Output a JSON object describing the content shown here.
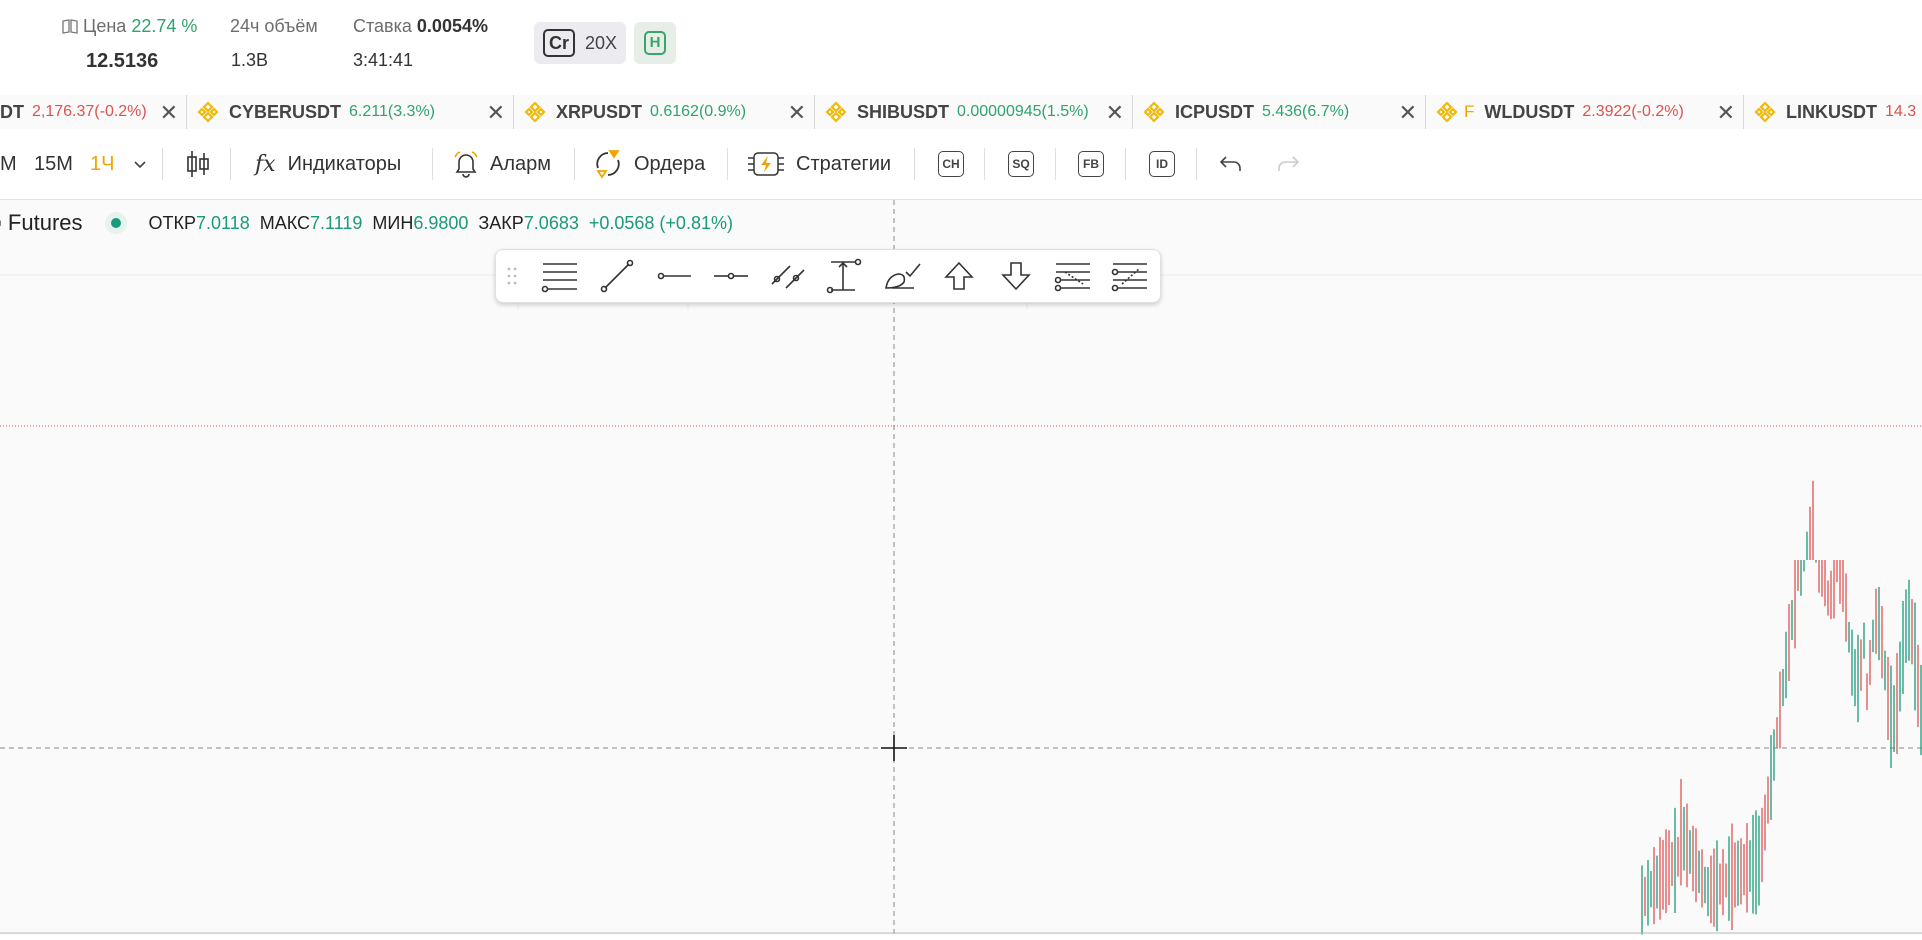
{
  "stats": {
    "price": {
      "label": "Цена",
      "pct": "22.74 %",
      "value": "12.5136"
    },
    "volume": {
      "label": "24ч объём",
      "value": "1.3B"
    },
    "rate": {
      "label": "Ставка",
      "pct": "0.0054%",
      "value": "3:41:41"
    },
    "cr_label": "Cr",
    "leverage": "20X",
    "h_label": "H"
  },
  "tabs": [
    {
      "symbol": "DT",
      "change": "2,176.37(-0.2%)",
      "direction": "down",
      "prefix": "",
      "close": "✕"
    },
    {
      "symbol": "CYBERUSDT",
      "change": "6.211(3.3%)",
      "direction": "up",
      "prefix": "",
      "close": "✕"
    },
    {
      "symbol": "XRPUSDT",
      "change": "0.6162(0.9%)",
      "direction": "up",
      "prefix": "",
      "close": "✕"
    },
    {
      "symbol": "SHIBUSDT",
      "change": "0.00000945(1.5%)",
      "direction": "up",
      "prefix": "",
      "close": "✕"
    },
    {
      "symbol": "ICPUSDT",
      "change": "5.436(6.7%)",
      "direction": "up",
      "prefix": "",
      "close": "✕"
    },
    {
      "symbol": "WLDUSDT",
      "change": "2.3922(-0.2%)",
      "direction": "down",
      "prefix": "F",
      "close": "✕"
    },
    {
      "symbol": "LINKUSDT",
      "change": "14.3",
      "direction": "down",
      "prefix": "",
      "close": ""
    }
  ],
  "toolbar": {
    "tf_m": "M",
    "tf_15m": "15M",
    "tf_1h": "1Ч",
    "indicators": "Индикаторы",
    "alarm": "Аларм",
    "orders": "Ордера",
    "strategies": "Стратегии",
    "ch": "CH",
    "sq": "SQ",
    "fb": "FB",
    "id": "ID"
  },
  "legend": {
    "title": "Futures",
    "open_label": "ОТКР",
    "open": "7.0118",
    "high_label": "МАКС",
    "high": "7.1119",
    "low_label": "МИН",
    "low": "6.9800",
    "close_label": "ЗАКР",
    "close": "7.0683",
    "change": "+0.0568 (+0.81%)"
  },
  "drawing_tools": [
    "horizontal-lines-icon",
    "trend-line-icon",
    "ray-icon",
    "horizontal-ray-icon",
    "parallel-channel-icon",
    "price-range-icon",
    "brush-icon",
    "arrow-up-icon",
    "arrow-down-icon",
    "fib-retracement-icon",
    "fib-extension-icon"
  ],
  "colors": {
    "up": "#2fa36b",
    "down": "#d9534f",
    "accent_orange": "#f0a500",
    "binance_yellow": "#f0b90b",
    "legend_teal": "#1a9a7a",
    "price_line": "#e05555"
  }
}
